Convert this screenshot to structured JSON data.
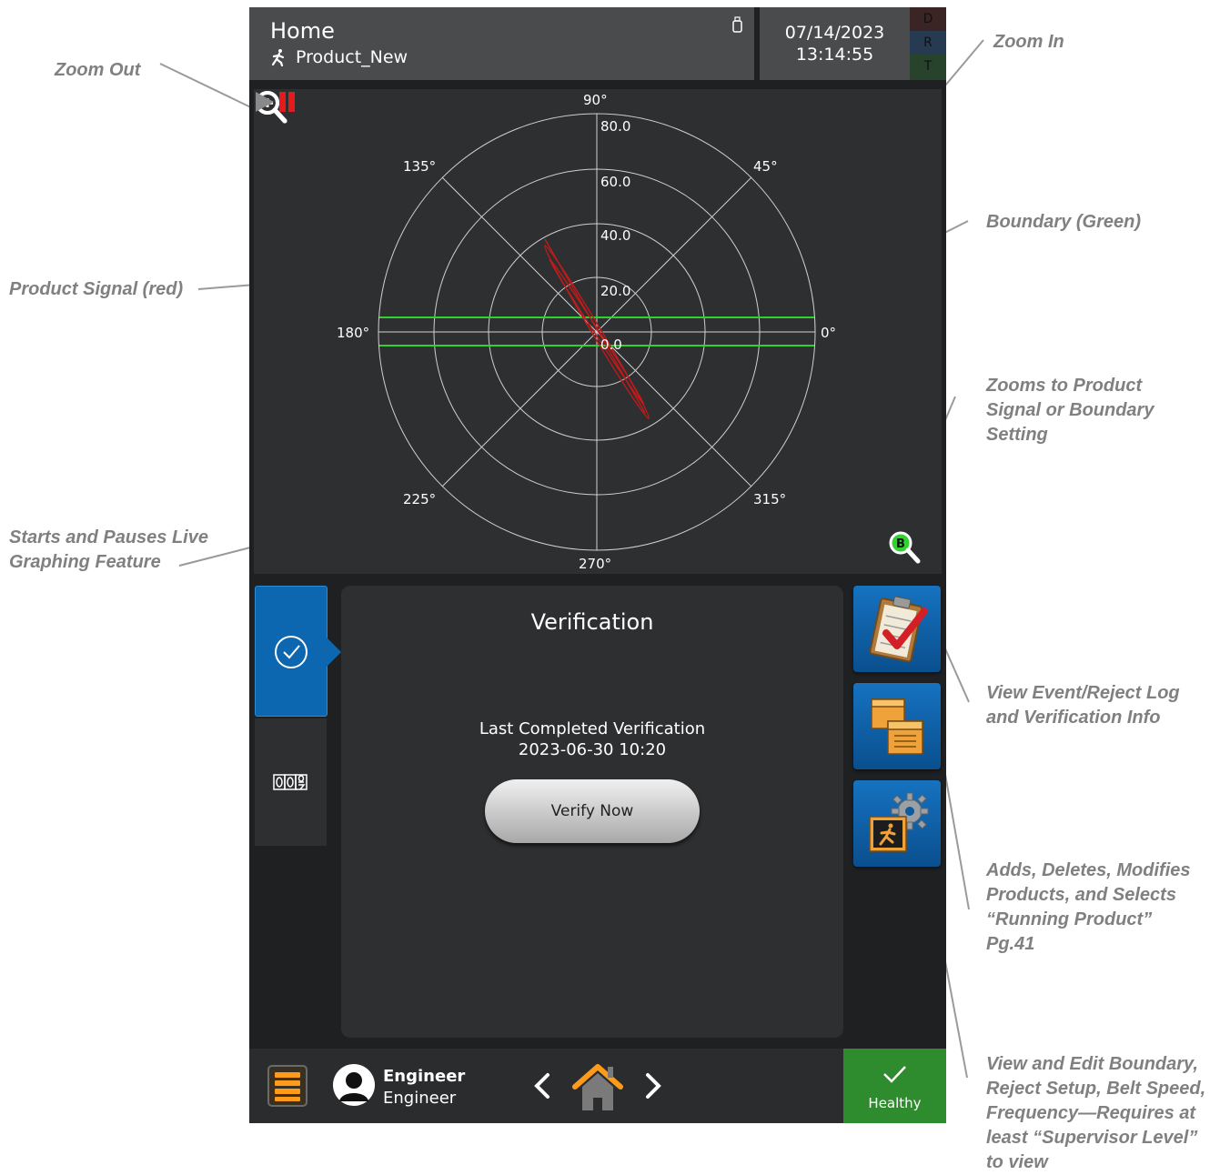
{
  "callouts": {
    "zoom_out": "Zoom Out",
    "zoom_in": "Zoom In",
    "boundary": "Boundary (Green)",
    "product_signal": "Product Signal (red)",
    "zooms_to": [
      "Zooms to Product",
      "Signal or Boundary",
      "Setting"
    ],
    "live_graph": [
      "Starts and Pauses Live",
      "Graphing Feature"
    ],
    "event_log": [
      "View Event/Reject Log",
      "and Verification Info"
    ],
    "products": [
      "Adds, Deletes, Modifies",
      "Products, and Selects",
      "“Running Product”",
      "Pg.41"
    ],
    "settings": [
      "View and Edit Boundary,",
      "Reject Setup, Belt Speed,",
      "Frequency—Requires at",
      "least “Supervisor Level”",
      "to view"
    ]
  },
  "header": {
    "title": "Home",
    "product": "Product_New",
    "date": "07/14/2023",
    "time": "13:14:55",
    "status_letters": [
      "D",
      "R",
      "T"
    ]
  },
  "polar": {
    "angle_labels": [
      "90°",
      "45°",
      "0°",
      "315°",
      "270°",
      "225°",
      "180°",
      "135°"
    ],
    "ring_labels": [
      "80.0",
      "60.0",
      "40.0",
      "20.0",
      "0.0"
    ],
    "boundary_color": "#2fd22f",
    "signal_color": "#c41a1a",
    "zoom_badge": "B"
  },
  "panel": {
    "title": "Verification",
    "last_label": "Last Completed Verification",
    "last_value": "2023-06-30 10:20",
    "verify_button": "Verify Now"
  },
  "bottom": {
    "user_name": "Engineer",
    "user_role": "Engineer",
    "status": "Healthy",
    "status_color": "#2e8b2e"
  }
}
